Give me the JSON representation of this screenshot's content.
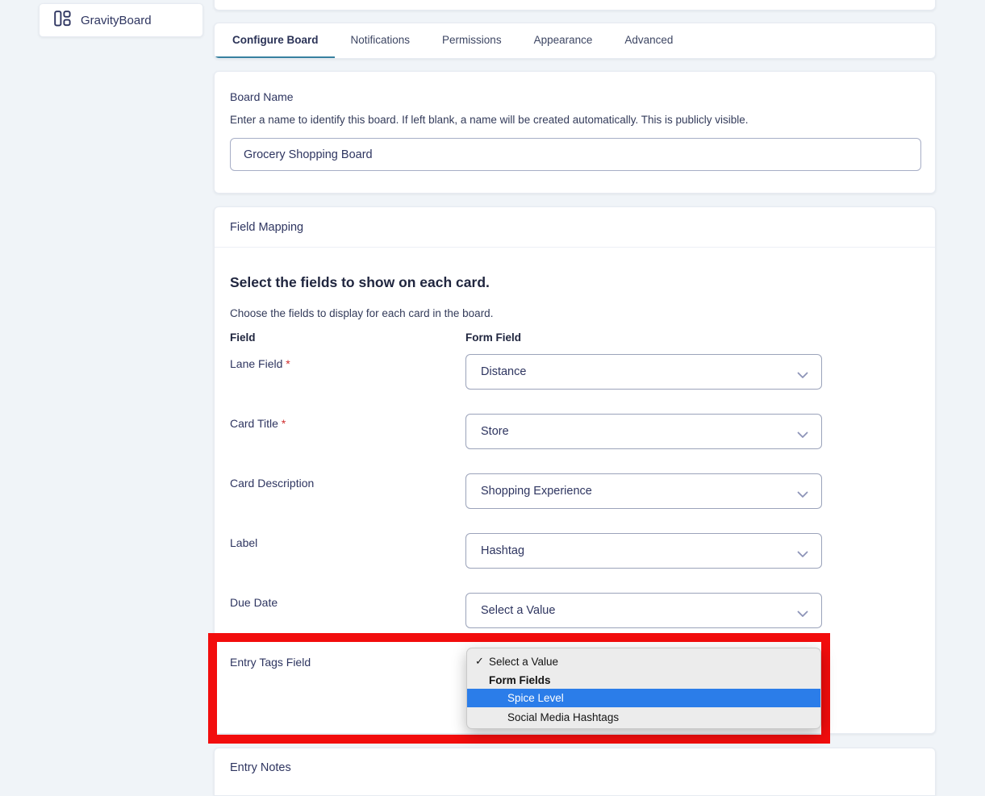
{
  "sidebar": {
    "app_label": "GravityBoard"
  },
  "tabs": {
    "configure": "Configure Board",
    "notifications": "Notifications",
    "permissions": "Permissions",
    "appearance": "Appearance",
    "advanced": "Advanced",
    "active": "Configure Board"
  },
  "board_name": {
    "label": "Board Name",
    "description": "Enter a name to identify this board. If left blank, a name will be created automatically. This is publicly visible.",
    "value": "Grocery Shopping Board"
  },
  "field_mapping": {
    "header": "Field Mapping",
    "title": "Select the fields to show on each card.",
    "subtitle": "Choose the fields to display for each card in the board.",
    "columns": {
      "field": "Field",
      "form_field": "Form Field"
    },
    "required_marker": "*",
    "rows": [
      {
        "label": "Lane Field",
        "required": "*",
        "value": "Distance"
      },
      {
        "label": "Card Title",
        "required": "*",
        "value": "Store"
      },
      {
        "label": "Card Description",
        "required": "",
        "value": "Shopping Experience"
      },
      {
        "label": "Label",
        "required": "",
        "value": "Hashtag"
      },
      {
        "label": "Due Date",
        "required": "",
        "value": "Select a Value"
      }
    ],
    "open_row": {
      "label": "Entry Tags Field",
      "menu": {
        "check_glyph": "✓",
        "selected_option": "Select a Value",
        "group_label": "Form Fields",
        "highlighted_option": "Spice Level",
        "option_2": "Social Media Hashtags"
      }
    }
  },
  "entry_notes": {
    "header": "Entry Notes"
  },
  "colors": {
    "accent_tab_underline": "#37809f",
    "menu_highlight_blue": "#2b7de9",
    "annotation_red": "#f20d0d",
    "required_red": "#cf2e2e",
    "page_background": "#f0f4f8"
  }
}
